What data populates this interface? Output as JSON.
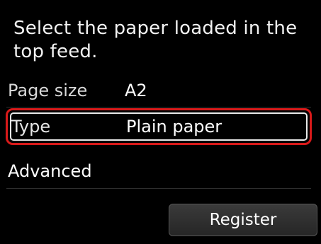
{
  "screen": {
    "instruction": "Select the paper loaded in the top feed."
  },
  "settings": {
    "page_size": {
      "label": "Page size",
      "value": "A2"
    },
    "type": {
      "label": "Type",
      "value": "Plain paper"
    },
    "advanced": {
      "label": "Advanced"
    }
  },
  "actions": {
    "register_label": "Register"
  },
  "colors": {
    "background": "#000000",
    "highlight_outline": "#d91a1a",
    "text": "#ffffff"
  }
}
